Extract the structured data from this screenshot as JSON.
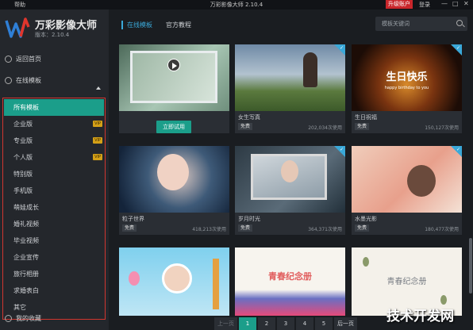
{
  "titlebar": {
    "help": "帮助",
    "title": "万彩影像大师 2.10.4",
    "upgrade": "升级账户",
    "login": "登录",
    "min": "—",
    "max": "□",
    "close": "✕"
  },
  "app": {
    "name": "万彩影像大师",
    "version": "版本：2.10.4"
  },
  "nav": {
    "home": "返回首页",
    "online": "在线模板",
    "favorites": "我的收藏"
  },
  "categories": [
    {
      "label": "所有模板",
      "selected": true,
      "badge": ""
    },
    {
      "label": "企业版",
      "badge": "VIP"
    },
    {
      "label": "专业版",
      "badge": "VIP"
    },
    {
      "label": "个人版",
      "badge": "VIP"
    },
    {
      "label": "特别版",
      "badge": ""
    },
    {
      "label": "手机版",
      "badge": ""
    },
    {
      "label": "萌娃成长",
      "badge": ""
    },
    {
      "label": "婚礼视频",
      "badge": ""
    },
    {
      "label": "毕业视频",
      "badge": ""
    },
    {
      "label": "企业宣传",
      "badge": ""
    },
    {
      "label": "旅行相册",
      "badge": ""
    },
    {
      "label": "求婚表白",
      "badge": ""
    },
    {
      "label": "其它",
      "badge": ""
    }
  ],
  "tabs": {
    "online": "在线模板",
    "tutorial": "官方教程"
  },
  "search": {
    "placeholder": "模板关键词"
  },
  "cards": [
    {
      "name": "",
      "button": "立即试用",
      "free": "",
      "uses": ""
    },
    {
      "name": "女生写真",
      "free": "免费",
      "uses": "202,034次使用"
    },
    {
      "name": "生日祝福",
      "free": "免费",
      "uses": "150,127次使用",
      "overlay": "生日快乐",
      "overlay2": "happy birthday to you"
    },
    {
      "name": "粒子世界",
      "free": "免费",
      "uses": "418,213次使用"
    },
    {
      "name": "岁月时光",
      "free": "免费",
      "uses": "364,371次使用"
    },
    {
      "name": "水墨光影",
      "free": "免费",
      "uses": "180,477次使用"
    },
    {
      "name": "",
      "free": "",
      "uses": ""
    },
    {
      "name": "",
      "free": "",
      "uses": "",
      "overlay": "青春纪念册"
    },
    {
      "name": "",
      "free": "",
      "uses": "",
      "overlay": "青春纪念册"
    }
  ],
  "pager": {
    "prev": "上一页",
    "p1": "1",
    "p2": "2",
    "p3": "3",
    "p4": "4",
    "p5": "5",
    "next": "后一页"
  },
  "watermark": "技术开发网"
}
